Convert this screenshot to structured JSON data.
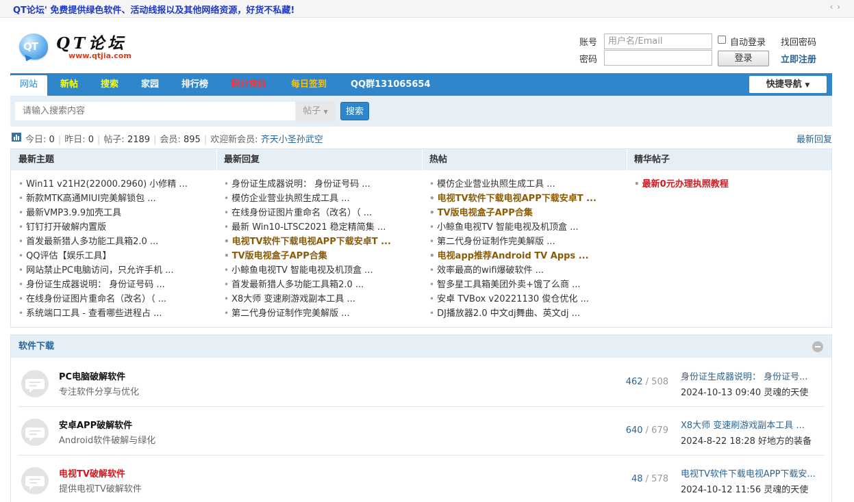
{
  "notice": {
    "text": "QT论坛' 免费提供绿色软件、活动线报以及其他网络资源，好货不私藏!",
    "arrows": "‹ ›"
  },
  "logo": {
    "bubble_text": "QT",
    "name": "QT论坛",
    "url": "www.qtjia.com"
  },
  "login": {
    "account_label": "账号",
    "password_label": "密码",
    "username_placeholder": "用户名/Email",
    "auto_login": "自动登录",
    "forgot_password": "找回密码",
    "login_button": "登录",
    "register": "立即注册"
  },
  "nav": {
    "items": [
      {
        "label": "网站",
        "color": "#2f86cb"
      },
      {
        "label": "新帖",
        "color": "#ffff00"
      },
      {
        "label": "搜索",
        "color": "#ffff00"
      },
      {
        "label": "家园",
        "color": "#ffffff"
      },
      {
        "label": "排行榜",
        "color": "#ffffff"
      },
      {
        "label": "积分充值",
        "color": "#ff3333"
      },
      {
        "label": "每日签到",
        "color": "#ffc000"
      },
      {
        "label": "QQ群131065654",
        "color": "#ffffff"
      }
    ],
    "quick_nav": "快捷导航",
    "quick_nav_icon": "caret-down-icon"
  },
  "search": {
    "placeholder": "请输入搜索内容",
    "type": "帖子",
    "type_icon": "caret-down-icon",
    "button": "搜索"
  },
  "stats": {
    "icon": "bar-chart-icon",
    "today_label": "今日:",
    "today": "0",
    "yesterday_label": "昨日:",
    "yesterday": "0",
    "posts_label": "帖子:",
    "posts": "2189",
    "members_label": "会员:",
    "members": "895",
    "welcome_label": "欢迎新会员:",
    "new_member": "齐天小圣孙武空",
    "latest_reply_link": "最新回复"
  },
  "columns": [
    {
      "title": "最新主题",
      "items": [
        {
          "text": "Win11 v21H2(22000.2960) 小修精 ...",
          "style": ""
        },
        {
          "text": "新款MTK高通MIUI完美解锁包 ...",
          "style": ""
        },
        {
          "text": "最新VMP3.9.9加壳工具",
          "style": ""
        },
        {
          "text": "钉钉打开破解内置版",
          "style": ""
        },
        {
          "text": "首发最新猎人多功能工具箱2.0 ...",
          "style": ""
        },
        {
          "text": "QQ评估【娱乐工具】",
          "style": ""
        },
        {
          "text": "网站禁止PC电脑访问，只允许手机 ...",
          "style": ""
        },
        {
          "text": "身份证生成器说明： 身份证号码 ...",
          "style": ""
        },
        {
          "text": "在线身份证图片重命名（改名）（ ...",
          "style": ""
        },
        {
          "text": "系统端口工具 - 查看哪些进程占 ...",
          "style": ""
        }
      ]
    },
    {
      "title": "最新回复",
      "items": [
        {
          "text": "身份证生成器说明： 身份证号码 ...",
          "style": ""
        },
        {
          "text": "模仿企业营业执照生成工具 ...",
          "style": ""
        },
        {
          "text": "在线身份证图片重命名（改名）（ ...",
          "style": ""
        },
        {
          "text": "最新 Win10-LTSC2021 稳定精简集 ...",
          "style": ""
        },
        {
          "text": "电视TV软件下载电视APP下载安卓T ...",
          "style": "hl"
        },
        {
          "text": "TV版电视盒子APP合集",
          "style": "hl"
        },
        {
          "text": "小鲸鱼电视TV 智能电视及机顶盒 ...",
          "style": ""
        },
        {
          "text": "首发最新猎人多功能工具箱2.0 ...",
          "style": ""
        },
        {
          "text": "X8大师 变速刷游戏副本工具 ...",
          "style": ""
        },
        {
          "text": "第二代身份证制作完美解版 ...",
          "style": ""
        }
      ]
    },
    {
      "title": "热帖",
      "items": [
        {
          "text": "模仿企业营业执照生成工具 ...",
          "style": ""
        },
        {
          "text": "电视TV软件下载电视APP下载安卓T ...",
          "style": "hl"
        },
        {
          "text": "TV版电视盒子APP合集",
          "style": "hl"
        },
        {
          "text": "小鲸鱼电视TV 智能电视及机顶盒 ...",
          "style": ""
        },
        {
          "text": "第二代身份证制作完美解版 ...",
          "style": ""
        },
        {
          "text": "电视app推荐Android TV Apps ...",
          "style": "hl"
        },
        {
          "text": "效率最高的wifi爆破软件 ...",
          "style": ""
        },
        {
          "text": "智多星工具箱美团外卖+饿了么商 ...",
          "style": ""
        },
        {
          "text": "安卓 TVBox v20221130 俊仓优化 ...",
          "style": ""
        },
        {
          "text": "DJ播放器2.0 中文dj舞曲、英文dj ...",
          "style": ""
        }
      ]
    },
    {
      "title": "精华帖子",
      "items": [
        {
          "text": "最新0元办理执照教程",
          "style": "red"
        }
      ]
    }
  ],
  "forum": {
    "title": "软件下载",
    "collapse_icon": "collapse-minus-icon",
    "rows": [
      {
        "name": "PC电脑破解软件",
        "name_style": "",
        "desc": "专注软件分享与优化",
        "threads": "462",
        "posts": "508",
        "last_title": "身份证生成器说明： 身份证号...",
        "last_meta": "2024-10-13 09:40 灵魂的天使"
      },
      {
        "name": "安卓APP破解软件",
        "name_style": "",
        "desc": "Android软件破解与绿化",
        "threads": "640",
        "posts": "679",
        "last_title": "X8大师 变速刷游戏副本工具 ...",
        "last_meta": "2024-8-22 18:28 好地方的装备"
      },
      {
        "name": "电视TV破解软件",
        "name_style": "red",
        "desc": "提供电视TV破解软件",
        "threads": "48",
        "posts": "578",
        "last_title": "电视TV软件下载电视APP下载安...",
        "last_meta": "2024-10-12 11:56 灵魂的天使"
      }
    ]
  }
}
